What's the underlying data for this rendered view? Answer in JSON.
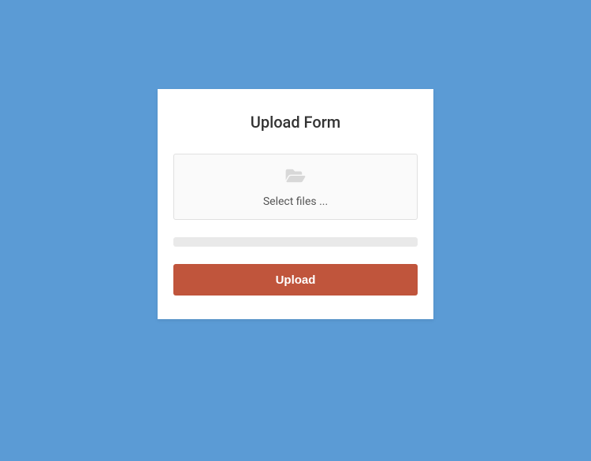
{
  "form": {
    "title": "Upload Form",
    "select_files_label": "Select files ...",
    "upload_button_label": "Upload"
  }
}
